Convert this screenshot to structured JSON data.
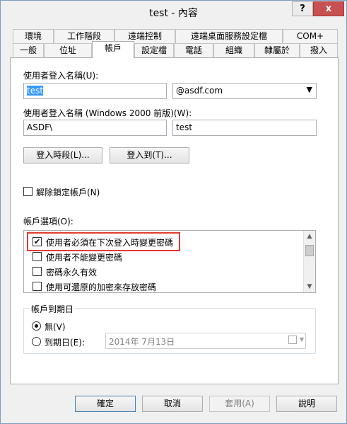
{
  "window": {
    "title": "test - 內容",
    "help_label": "?",
    "close_label": "x"
  },
  "tabs": {
    "row1": [
      "環境",
      "工作階段",
      "遠端控制",
      "遠端桌面服務設定檔",
      "COM+"
    ],
    "row2": [
      "一般",
      "位址",
      "帳戶",
      "設定檔",
      "電話",
      "組織",
      "隸屬於",
      "撥入"
    ],
    "active": "帳戶"
  },
  "account": {
    "logon_name_label": "使用者登入名稱(U):",
    "logon_name_value": "test",
    "domain_value": "@asdf.com",
    "logon_name_pre2000_label": "使用者登入名稱 (Windows 2000 前版)(W):",
    "pre2000_domain": "ASDF\\",
    "pre2000_name": "test",
    "logon_hours_button": "登入時段(L)...",
    "logon_to_button": "登入到(T)...",
    "unlock_label": "解除鎖定帳戶(N)",
    "options_label": "帳戶選項(O):",
    "options": [
      {
        "label": "使用者必須在下次登入時變更密碼",
        "checked": true
      },
      {
        "label": "使用者不能變更密碼",
        "checked": false
      },
      {
        "label": "密碼永久有效",
        "checked": false
      },
      {
        "label": "使用可還原的加密來存放密碼",
        "checked": false
      }
    ],
    "expires_label": "帳戶到期日",
    "never_label": "無(V)",
    "end_of_label": "到期日(E):",
    "date_value": "2014年  7月13日"
  },
  "buttons": {
    "ok": "確定",
    "cancel": "取消",
    "apply": "套用(A)",
    "help": "說明"
  },
  "colors": {
    "highlight_border": "#e03c31",
    "selection": "#3399ff"
  }
}
